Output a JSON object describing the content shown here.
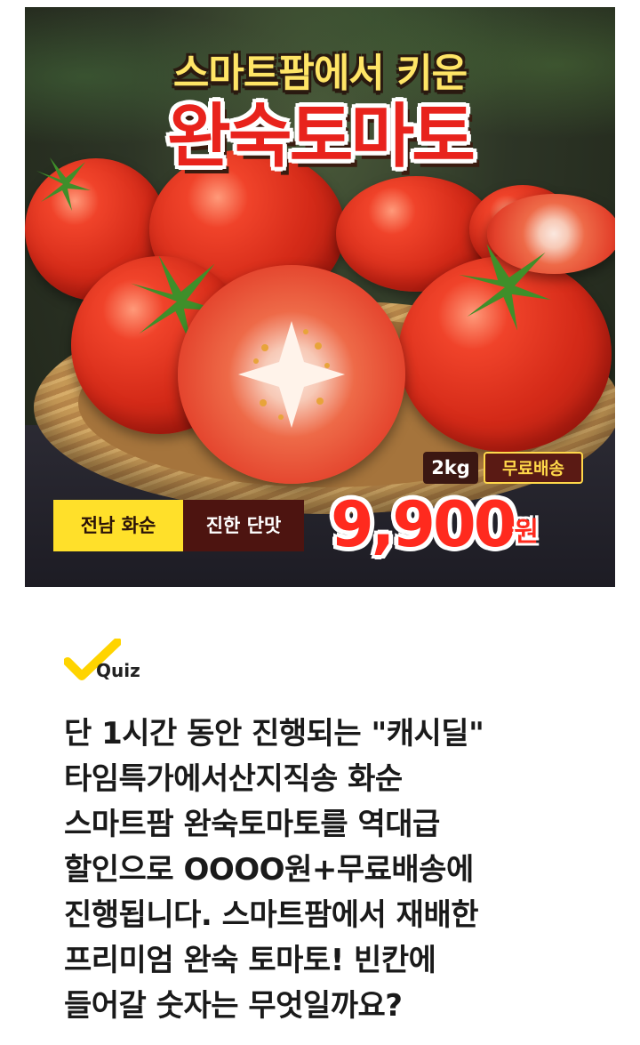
{
  "banner": {
    "headline_top": "스마트팜에서 키운",
    "headline_main": "완숙토마토",
    "weight_badge": "2kg",
    "shipping_badge": "무료배송",
    "origin_badge": "전남 화순",
    "taste_badge": "진한 단맛",
    "price": "9,900",
    "price_unit": "원"
  },
  "quiz": {
    "label": "Quiz",
    "question_lines": [
      "단 1시간 동안 진행되는 \"캐시딜\"",
      "타임특가에서산지직송 화순",
      "스마트팜 완숙토마토를 역대급",
      "할인으로 OOOO원+무료배송에",
      "진행됩니다. 스마트팜에서 재배한",
      "프리미엄 완숙 토마토! 빈칸에",
      "들어갈 숫자는 무엇일까요?"
    ]
  },
  "colors": {
    "accent_yellow": "#ffd400",
    "price_red": "#ff2a1e",
    "text_dark": "#1a1a1a"
  }
}
